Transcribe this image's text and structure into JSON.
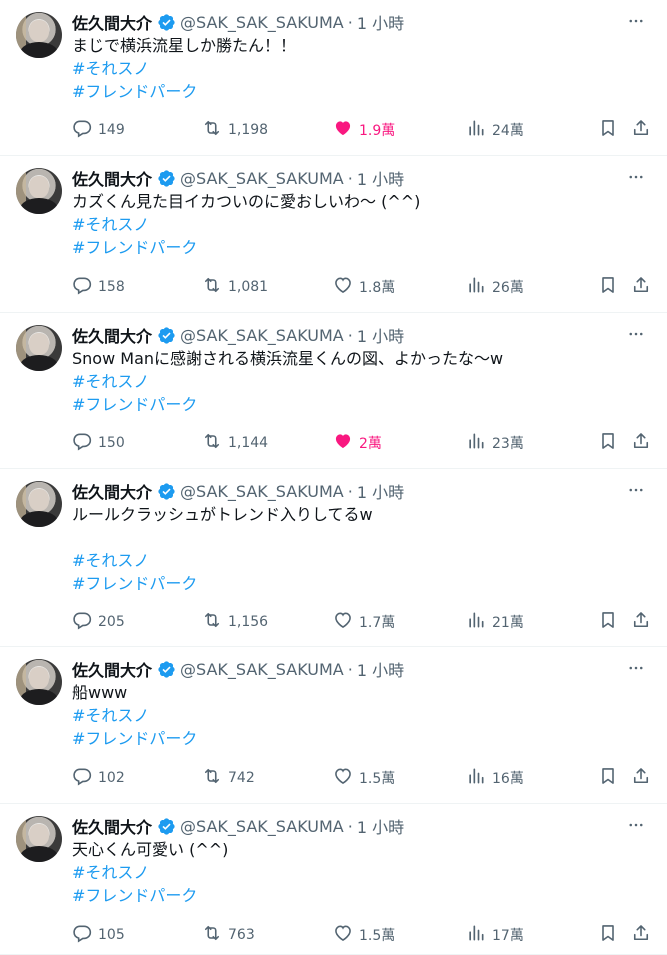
{
  "colors": {
    "accent": "#1d9bf0",
    "like": "#f91880",
    "muted": "#536471",
    "text": "#0f1419"
  },
  "tweets": [
    {
      "name": "佐久間大介",
      "handle": "@SAK_SAK_SAKUMA",
      "sep": "·",
      "time": "1 小時",
      "lines": [
        "まじで横浜流星しか勝たん！！"
      ],
      "tags": [
        "#それスノ",
        "#フレンドパーク"
      ],
      "replies": "149",
      "retweets": "1,198",
      "likes": "1.9萬",
      "liked": true,
      "views": "24萬"
    },
    {
      "name": "佐久間大介",
      "handle": "@SAK_SAK_SAKUMA",
      "sep": "·",
      "time": "1 小時",
      "lines": [
        "カズくん見た目イカついのに愛おしいわ〜 (^^)"
      ],
      "tags": [
        "#それスノ",
        "#フレンドパーク"
      ],
      "replies": "158",
      "retweets": "1,081",
      "likes": "1.8萬",
      "liked": false,
      "views": "26萬"
    },
    {
      "name": "佐久間大介",
      "handle": "@SAK_SAK_SAKUMA",
      "sep": "·",
      "time": "1 小時",
      "lines": [
        "Snow Manに感謝される横浜流星くんの図、よかったな〜w"
      ],
      "tags": [
        "#それスノ",
        "#フレンドパーク"
      ],
      "replies": "150",
      "retweets": "1,144",
      "likes": "2萬",
      "liked": true,
      "views": "23萬"
    },
    {
      "name": "佐久間大介",
      "handle": "@SAK_SAK_SAKUMA",
      "sep": "·",
      "time": "1 小時",
      "lines": [
        "ルールクラッシュがトレンド入りしてるw",
        ""
      ],
      "tags": [
        "#それスノ",
        "#フレンドパーク"
      ],
      "replies": "205",
      "retweets": "1,156",
      "likes": "1.7萬",
      "liked": false,
      "views": "21萬"
    },
    {
      "name": "佐久間大介",
      "handle": "@SAK_SAK_SAKUMA",
      "sep": "·",
      "time": "1 小時",
      "lines": [
        "船www"
      ],
      "tags": [
        "#それスノ",
        "#フレンドパーク"
      ],
      "replies": "102",
      "retweets": "742",
      "likes": "1.5萬",
      "liked": false,
      "views": "16萬"
    },
    {
      "name": "佐久間大介",
      "handle": "@SAK_SAK_SAKUMA",
      "sep": "·",
      "time": "1 小時",
      "lines": [
        "天心くん可愛い (^^)"
      ],
      "tags": [
        "#それスノ",
        "#フレンドパーク"
      ],
      "replies": "105",
      "retweets": "763",
      "likes": "1.5萬",
      "liked": false,
      "views": "17萬"
    }
  ]
}
